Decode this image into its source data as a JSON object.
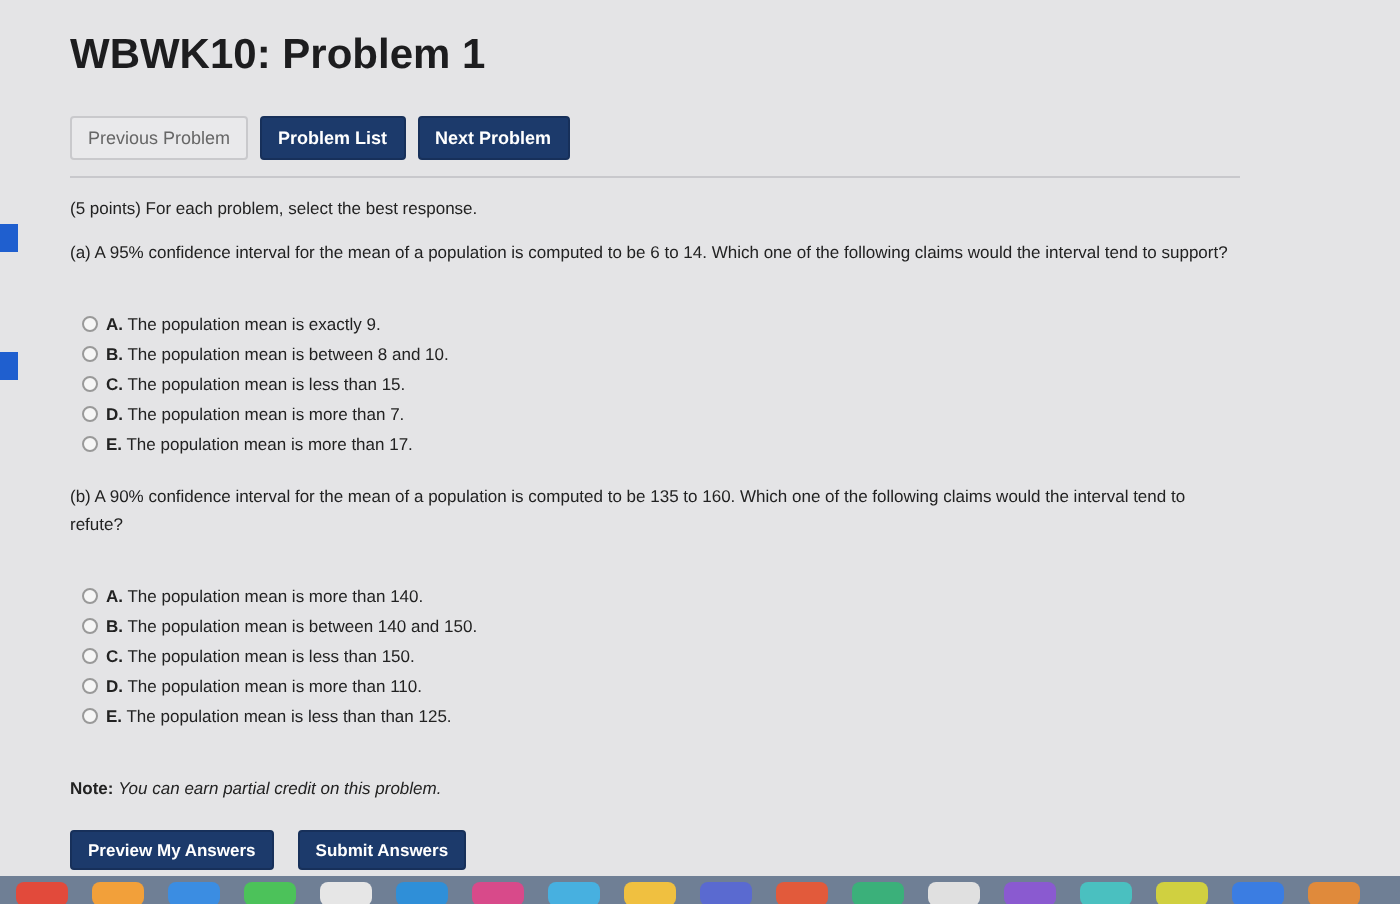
{
  "title": "WBWK10: Problem 1",
  "nav_buttons": [
    {
      "label": "Previous Problem",
      "disabled": true
    },
    {
      "label": "Problem List",
      "disabled": false
    },
    {
      "label": "Next Problem",
      "disabled": false
    }
  ],
  "intro": "(5 points) For each problem, select the best response.",
  "parts": [
    {
      "question": "(a) A 95% confidence interval for the mean of a population is computed to be 6 to 14. Which one of the following claims would the interval tend to support?",
      "options": [
        {
          "text": "**A.** The population mean is exactly 9.",
          "selected": false
        },
        {
          "text": "**B.** The population mean is between 8 and 10.",
          "selected": false
        },
        {
          "text": "**C.** The population mean is less than 15.",
          "selected": false
        },
        {
          "text": "**D.** The population mean is more than 7.",
          "selected": false
        },
        {
          "text": "**E.** The population mean is more than 17.",
          "selected": false
        }
      ]
    },
    {
      "question": "(b) A 90% confidence interval for the mean of a population is computed to be 135 to 160. Which one of the following claims would the interval tend to refute?",
      "options": [
        {
          "text": "**A.** The population mean is more than 140.",
          "selected": false
        },
        {
          "text": "**B.** The population mean is between 140 and 150.",
          "selected": false
        },
        {
          "text": "**C.** The population mean is less than 150.",
          "selected": false
        },
        {
          "text": "**D.** The population mean is more than 110.",
          "selected": false
        },
        {
          "text": "**E.** The population mean is less than than 125.",
          "selected": false
        }
      ]
    }
  ],
  "note": "**Note:** *You can earn partial credit on this problem.*",
  "actions": [
    "Preview My Answers",
    "Submit Answers"
  ]
}
